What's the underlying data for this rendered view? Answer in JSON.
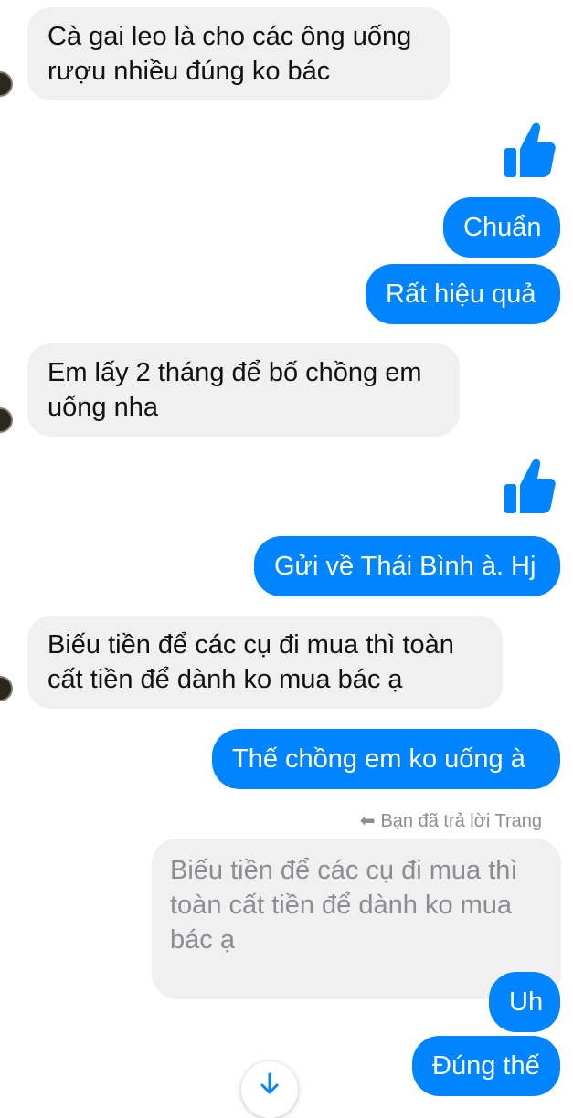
{
  "messages": {
    "m1": "Cà gai leo là cho các ông uống\nrượu nhiều đúng ko bác",
    "m2": "Chuẩn",
    "m3": "Rất hiệu quả",
    "m4": "Em lấy 2 tháng để bố chồng em\nuống nha",
    "m5": "Gửi về Thái Bình à. Hj",
    "m6": "Biếu tiền để các cụ đi mua thì toàn\ncất tiền để dành ko mua bác ạ",
    "m7": "Thế chồng em ko uống à",
    "reply_note": "Bạn đã trả lời Trang",
    "quoted": "Biếu tiền để các cụ đi mua thì\ntoàn cất tiền để dành ko mua\nbác ạ",
    "m8": "Uh",
    "m9": "Đúng thế"
  },
  "icons": {
    "like": "thumbs-up-icon",
    "reply": "reply-arrow-icon",
    "scroll": "arrow-down-icon"
  },
  "colors": {
    "outgoing_bubble": "#0084ff",
    "incoming_bubble": "#f0f0f0",
    "meta_text": "#8a8d91"
  }
}
